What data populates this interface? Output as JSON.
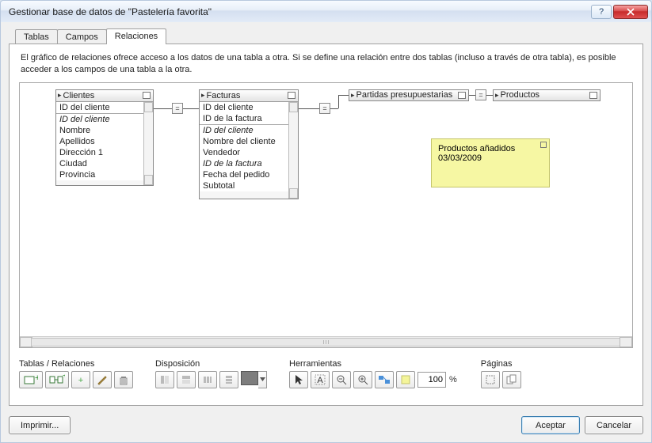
{
  "window": {
    "title": "Gestionar base de datos de \"Pastelería favorita\""
  },
  "tabs": [
    {
      "label": "Tablas"
    },
    {
      "label": "Campos"
    },
    {
      "label": "Relaciones",
      "active": true
    }
  ],
  "info_text": "El gráfico de relaciones ofrece acceso a los datos de una tabla a otra. Si se define una relación entre dos tablas (incluso a través de otra tabla), es posible acceder a los campos de una tabla a la otra.",
  "tables": {
    "clientes": {
      "title": "Clientes",
      "keys": [
        "ID del cliente"
      ],
      "fields": [
        "ID del cliente",
        "Nombre",
        "Apellidos",
        "Dirección 1",
        "Ciudad",
        "Provincia"
      ]
    },
    "facturas": {
      "title": "Facturas",
      "keys": [
        "ID del cliente",
        "ID de la factura"
      ],
      "fields": [
        "ID del cliente",
        "Nombre del cliente",
        "Vendedor",
        "ID de la factura",
        "Fecha del pedido",
        "Subtotal"
      ]
    },
    "partidas": {
      "title": "Partidas presupuestarias"
    },
    "productos": {
      "title": "Productos"
    }
  },
  "note": {
    "line1": "Productos añadidos",
    "line2": "03/03/2009"
  },
  "groups": {
    "tablas": "Tablas / Relaciones",
    "disposicion": "Disposición",
    "herramientas": "Herramientas",
    "paginas": "Páginas"
  },
  "zoom": {
    "value": "100",
    "pct": "%"
  },
  "buttons": {
    "print": "Imprimir...",
    "ok": "Aceptar",
    "cancel": "Cancelar"
  },
  "rel_symbol": "="
}
